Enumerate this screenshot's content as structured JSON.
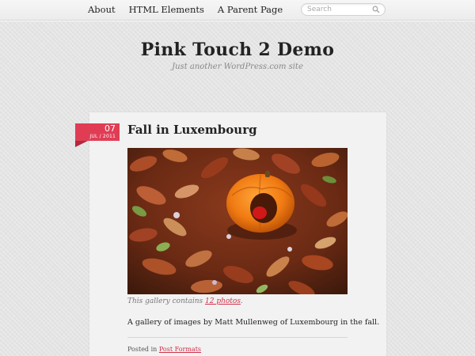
{
  "nav": {
    "items": [
      {
        "label": "About"
      },
      {
        "label": "HTML Elements"
      },
      {
        "label": "A Parent Page"
      }
    ]
  },
  "search": {
    "placeholder": "Search",
    "icon": "search-icon"
  },
  "site": {
    "title": "Pink Touch 2 Demo",
    "description": "Just another WordPress.com site"
  },
  "post": {
    "date_day": "07",
    "date_month_year": "JUL / 2011",
    "title": "Fall in Luxembourg",
    "image_subject": "pumpkin-on-autumn-leaves",
    "caption_prefix": "This gallery contains ",
    "caption_link": "12 photos",
    "caption_suffix": ".",
    "excerpt": "A gallery of images by Matt Mullenweg of Luxembourg in the fall.",
    "posted_in_label": "Posted in ",
    "category": "Post Formats"
  },
  "colors": {
    "accent": "#e03d55",
    "link": "#d0304a",
    "background": "#e4e4e4"
  }
}
